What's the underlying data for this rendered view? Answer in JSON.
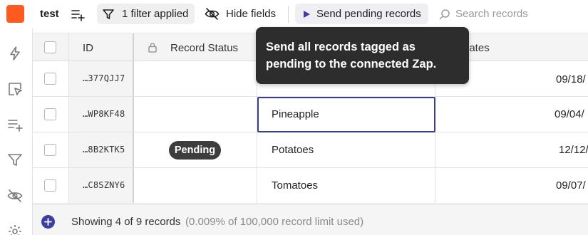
{
  "toolbar": {
    "title": "test",
    "filter_label": "1 filter applied",
    "hide_label": "Hide fields",
    "send_label": "Send pending records",
    "search_placeholder": "Search records",
    "brand_color": "#ff5a1f"
  },
  "rail": {
    "icons": [
      "bolt-icon",
      "select-cursor-icon",
      "add-list-icon",
      "filter-icon",
      "eye-off-icon",
      "gear-icon"
    ]
  },
  "table": {
    "columns": {
      "id": "ID",
      "status": "Record Status",
      "updates": "dates"
    },
    "rows": [
      {
        "id": "…377QJJ7",
        "status": "",
        "item": "",
        "date": "09/18/"
      },
      {
        "id": "…WP8KF48",
        "status": "",
        "item": "Pineapple",
        "date": "09/04/"
      },
      {
        "id": "…8B2KTK5",
        "status": "Pending",
        "item": "Potatoes",
        "date": "12/12/"
      },
      {
        "id": "…C8SZNY6",
        "status": "",
        "item": "Tomatoes",
        "date": "09/07/"
      }
    ]
  },
  "footer": {
    "showing": "Showing 4 of 9 records",
    "limit": "(0.009% of 100,000 record limit used)"
  },
  "tooltip": {
    "line1": "Send all records tagged as",
    "line2": "pending to the connected Zap."
  }
}
